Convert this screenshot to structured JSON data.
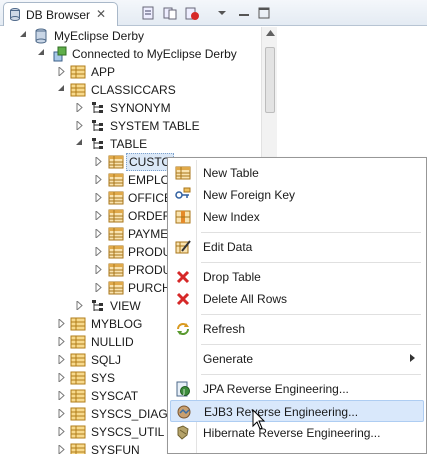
{
  "tab": {
    "title": "DB Browser",
    "close_glyph": "✕"
  },
  "tree": {
    "root": "MyEclipse Derby",
    "connection": "Connected to MyEclipse Derby",
    "schemas_before": [
      "APP",
      "CLASSICCARS"
    ],
    "classiccars_children": [
      "SYNONYM",
      "SYSTEM TABLE",
      "TABLE"
    ],
    "tables": [
      "CUSTO",
      "EMPLO",
      "OFFICE",
      "ORDER",
      "PAYME",
      "PRODU",
      "PRODU",
      "PURCH"
    ],
    "view": "VIEW",
    "schemas_after": [
      "MYBLOG",
      "NULLID",
      "SQLJ",
      "SYS",
      "SYSCAT",
      "SYSCS_DIAG",
      "SYSCS_UTIL",
      "SYSFUN"
    ]
  },
  "menu": {
    "items": [
      {
        "label": "New Table",
        "icon": "table-icon"
      },
      {
        "label": "New Foreign Key",
        "icon": "foreign-key-icon"
      },
      {
        "label": "New Index",
        "icon": "index-icon"
      },
      {
        "label": "Edit Data",
        "icon": "edit-data-icon"
      },
      {
        "label": "Drop Table",
        "icon": "drop-icon"
      },
      {
        "label": "Delete All Rows",
        "icon": "delete-icon"
      },
      {
        "label": "Refresh",
        "icon": "refresh-icon"
      },
      {
        "label": "Generate",
        "icon": ""
      },
      {
        "label": "JPA Reverse Engineering...",
        "icon": "jpa-icon"
      },
      {
        "label": "EJB3 Reverse Engineering...",
        "icon": "ejb3-icon"
      },
      {
        "label": "Hibernate Reverse Engineering...",
        "icon": "hibernate-icon"
      }
    ]
  },
  "colors": {
    "accent": "#3a6ea5",
    "hover": "#d9e8fb",
    "selection": "#dbe8f7",
    "delete_red": "#d62828"
  }
}
